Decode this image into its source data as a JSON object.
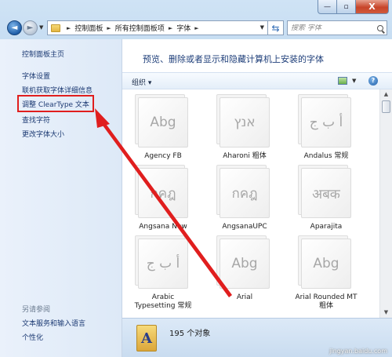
{
  "window": {
    "min_label": "—",
    "max_label": "▫",
    "close_label": "X"
  },
  "nav": {
    "back_glyph": "◄",
    "forward_glyph": "►"
  },
  "address": {
    "crumbs": [
      "控制面板",
      "所有控制面板项",
      "字体"
    ]
  },
  "search": {
    "placeholder": "搜索 字体"
  },
  "sidebar": {
    "items": [
      "控制面板主页",
      "字体设置",
      "联机获取字体详细信息",
      "调整 ClearType 文本",
      "查找字符",
      "更改字体大小"
    ],
    "see_also_title": "另请参阅",
    "see_also": [
      "文本服务和输入语言",
      "个性化"
    ]
  },
  "main": {
    "heading": "预览、删除或者显示和隐藏计算机上安装的字体"
  },
  "toolbar": {
    "organize_label": "组织 ▾"
  },
  "fonts": [
    {
      "name": "Agency FB",
      "sample": "Abg"
    },
    {
      "name": "Aharoni 粗体",
      "sample": "אנץ"
    },
    {
      "name": "Andalus 常规",
      "sample": "أ ب ج"
    },
    {
      "name": "Angsana New",
      "sample": "กคฎ"
    },
    {
      "name": "AngsanaUPC",
      "sample": "กคฎ"
    },
    {
      "name": "Aparajita",
      "sample": "अबक"
    },
    {
      "name": "Arabic Typesetting 常规",
      "sample": "أ ب ج"
    },
    {
      "name": "Arial",
      "sample": "Abg"
    },
    {
      "name": "Arial Rounded MT 粗体",
      "sample": "Abg"
    }
  ],
  "status": {
    "count": "195 个对象"
  },
  "watermark": "jingyan.baidu.com",
  "colors": {
    "highlight_box": "#e01e1e",
    "arrow": "#e01e1e"
  }
}
